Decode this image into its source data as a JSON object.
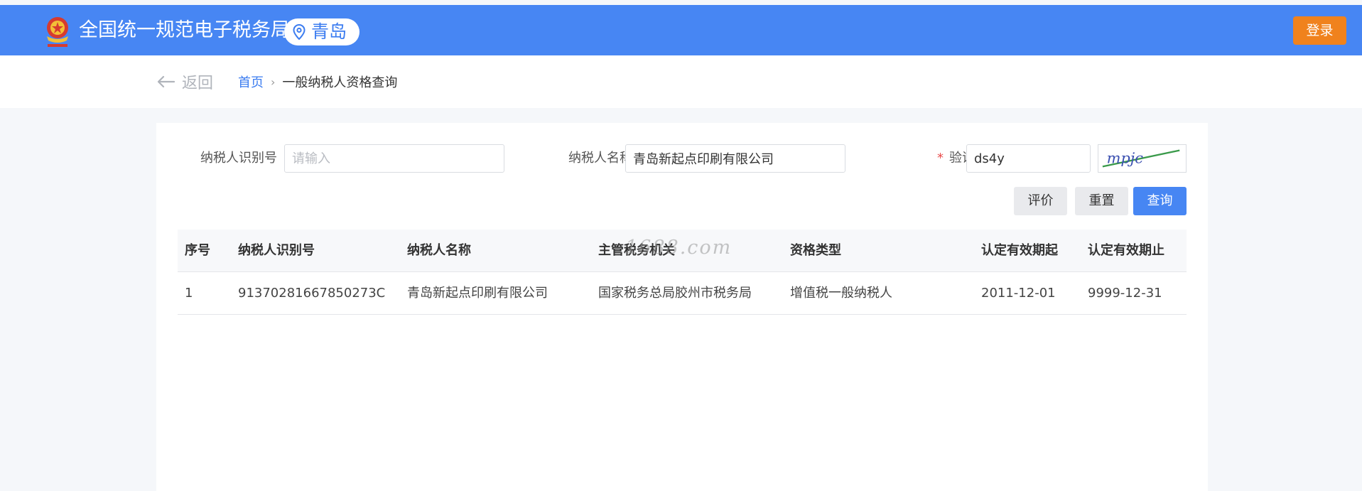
{
  "header": {
    "title": "全国统一规范电子税务局",
    "city": "青岛",
    "login_label": "登录",
    "brand_color": "#4786f3",
    "login_color": "#f0821d"
  },
  "nav": {
    "back_label": "返回",
    "breadcrumb": {
      "home": "首页",
      "separator": "›",
      "current": "一般纳税人资格查询"
    }
  },
  "form": {
    "taxpayer_id": {
      "label": "纳税人识别号",
      "value": "",
      "placeholder": "请输入"
    },
    "taxpayer_name": {
      "label": "纳税人名称",
      "value": "青岛新起点印刷有限公司"
    },
    "captcha": {
      "required_mark": "*",
      "label": "验证码",
      "value": "ds4y",
      "image_text": "mpjc"
    },
    "buttons": {
      "evaluate": "评价",
      "reset": "重置",
      "query": "查询"
    }
  },
  "table": {
    "columns": [
      "序号",
      "纳税人识别号",
      "纳税人名称",
      "主管税务机关",
      "资格类型",
      "认定有效期起",
      "认定有效期止"
    ],
    "rows": [
      [
        "1",
        "91370281667850273C",
        "青岛新起点印刷有限公司",
        "国家税务总局胶州市税务局",
        "增值税一般纳税人",
        "2011-12-01",
        "9999-12-31"
      ]
    ]
  },
  "watermark": "1688.com"
}
